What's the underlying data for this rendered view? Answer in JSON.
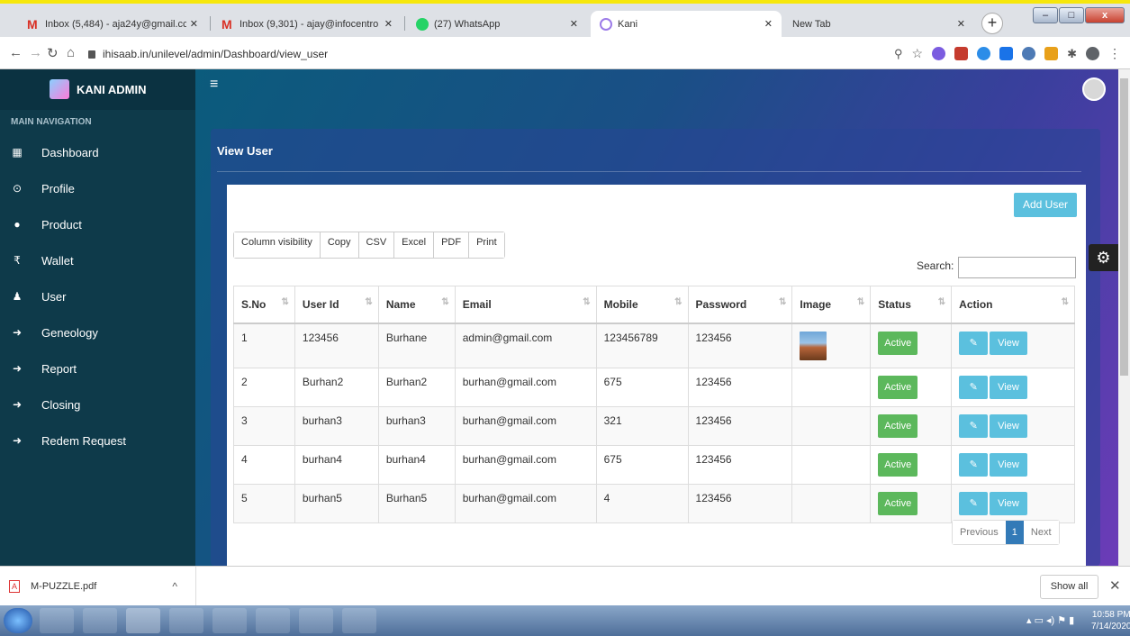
{
  "browser": {
    "tabs": [
      {
        "label": "Inbox (5,484) - aja24y@gmail.cc",
        "icon": "gmail-icon"
      },
      {
        "label": "Inbox (9,301) - ajay@infocentro",
        "icon": "gmail-icon"
      },
      {
        "label": "(27) WhatsApp",
        "icon": "whatsapp-icon"
      },
      {
        "label": "Kani",
        "icon": "kani-icon"
      },
      {
        "label": "New Tab",
        "icon": ""
      }
    ],
    "url": "ihisaab.in/unilevel/admin/Dashboard/view_user"
  },
  "sidebar": {
    "brand": "KANI ADMIN",
    "header": "MAIN NAVIGATION",
    "items": [
      {
        "label": "Dashboard",
        "icon": "dashboard-icon"
      },
      {
        "label": "Profile",
        "icon": "profile-icon"
      },
      {
        "label": "Product",
        "icon": "product-icon"
      },
      {
        "label": "Wallet",
        "icon": "rupee-icon"
      },
      {
        "label": "User",
        "icon": "user-icon"
      },
      {
        "label": "Geneology",
        "icon": "arrow-right-icon"
      },
      {
        "label": "Report",
        "icon": "arrow-right-icon"
      },
      {
        "label": "Closing",
        "icon": "arrow-right-icon"
      },
      {
        "label": "Redem Request",
        "icon": "arrow-right-icon"
      }
    ]
  },
  "main": {
    "title": "View User",
    "add_user": "Add User",
    "export_buttons": [
      "Column visibility",
      "Copy",
      "CSV",
      "Excel",
      "PDF",
      "Print"
    ],
    "search_label": "Search:",
    "columns": [
      "S.No",
      "User Id",
      "Name",
      "Email",
      "Mobile",
      "Password",
      "Image",
      "Status",
      "Action"
    ],
    "rows": [
      {
        "sno": "1",
        "userid": "123456",
        "name": "Burhane",
        "email": "admin@gmail.com",
        "mobile": "123456789",
        "password": "123456",
        "has_image": true,
        "status": "Active"
      },
      {
        "sno": "2",
        "userid": "Burhan2",
        "name": "Burhan2",
        "email": "burhan@gmail.com",
        "mobile": "675",
        "password": "123456",
        "has_image": false,
        "status": "Active"
      },
      {
        "sno": "3",
        "userid": "burhan3",
        "name": "burhan3",
        "email": "burhan@gmail.com",
        "mobile": "321",
        "password": "123456",
        "has_image": false,
        "status": "Active"
      },
      {
        "sno": "4",
        "userid": "burhan4",
        "name": "burhan4",
        "email": "burhan@gmail.com",
        "mobile": "675",
        "password": "123456",
        "has_image": false,
        "status": "Active"
      },
      {
        "sno": "5",
        "userid": "burhan5",
        "name": "Burhan5",
        "email": "burhan@gmail.com",
        "mobile": "4",
        "password": "123456",
        "has_image": false,
        "status": "Active"
      }
    ],
    "view_label": "View",
    "pager": {
      "prev": "Previous",
      "page": "1",
      "next": "Next"
    }
  },
  "downloads": {
    "file": "M-PUZZLE.pdf",
    "show_all": "Show all"
  },
  "taskbar": {
    "time": "10:58 PM",
    "date": "7/14/2020"
  },
  "colors": {
    "sidebar": "#0e3a4a",
    "info_button": "#5bc0de",
    "active_badge": "#5cb85c",
    "page_button": "#337ab7"
  }
}
